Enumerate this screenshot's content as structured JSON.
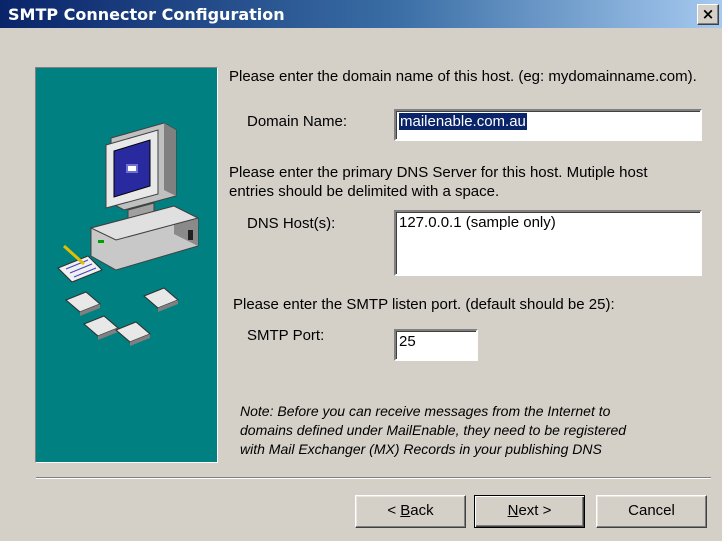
{
  "window": {
    "title": "SMTP Connector Configuration",
    "close_glyph": "×"
  },
  "side_image": {
    "icons": [
      "computer-icon",
      "notepad-icon",
      "envelope-icon"
    ]
  },
  "domain_section": {
    "instruction": "Please enter the domain name of this host. (eg: mydomainname.com).",
    "label": "Domain Name:",
    "value": "mailenable.com.au"
  },
  "dns_section": {
    "instruction_line1": "Please enter the primary DNS Server for this host. Mutiple host",
    "instruction_line2": "entries should be delimited with a space.",
    "label": "DNS Host(s):",
    "value": "127.0.0.1 (sample only)"
  },
  "port_section": {
    "instruction": "Please enter the SMTP listen port. (default should be 25):",
    "label": "SMTP Port:",
    "value": "25"
  },
  "note": {
    "line1": "Note: Before you can receive messages from the Internet to",
    "line2": "domains defined under MailEnable, they need to be registered",
    "line3": "with Mail Exchanger (MX) Records in your publishing DNS"
  },
  "buttons": {
    "back_prefix": "< ",
    "back_mnemonic": "B",
    "back_rest": "ack",
    "next_mnemonic": "N",
    "next_rest": "ext >",
    "cancel": "Cancel"
  },
  "colors": {
    "title_bar": "#0a246a",
    "panel": "#008080",
    "dialog": "#d4d0c8",
    "selection": "#0a246a"
  }
}
